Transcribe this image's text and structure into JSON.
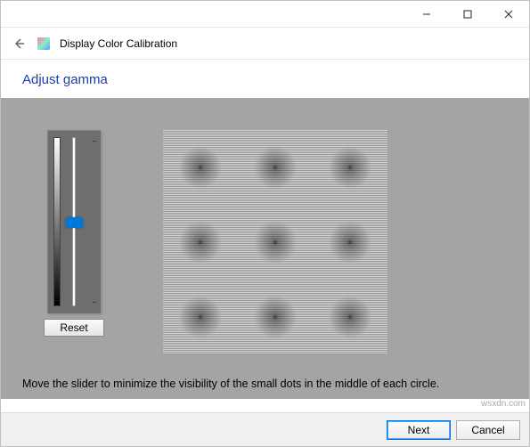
{
  "window": {
    "app_icon": "dccw-icon",
    "title": "Display Color Calibration",
    "controls": {
      "minimize": "min",
      "maximize": "max",
      "close": "close"
    }
  },
  "page": {
    "heading": "Adjust gamma",
    "instruction": "Move the slider to minimize the visibility of the small dots in the middle of each circle."
  },
  "slider": {
    "value": 50,
    "min": 0,
    "max": 100
  },
  "buttons": {
    "reset": "Reset",
    "next": "Next",
    "cancel": "Cancel"
  },
  "watermark": "wsxdn.com"
}
